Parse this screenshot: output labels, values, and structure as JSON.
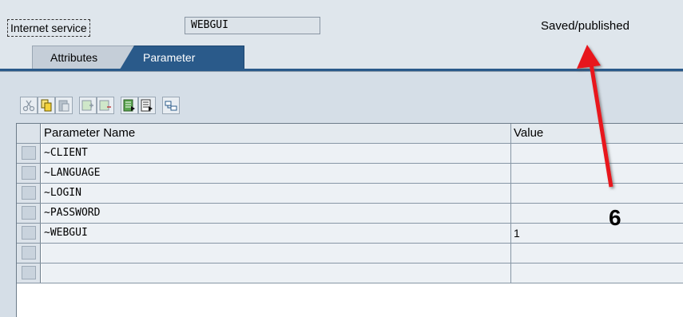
{
  "header": {
    "field_label": "Internet service",
    "field_value": "WEBGUI",
    "status": "Saved/published"
  },
  "tabs": [
    {
      "label": "Attributes",
      "active": false
    },
    {
      "label": "Parameter",
      "active": true
    }
  ],
  "toolbar": {
    "buttons": [
      "cut-icon",
      "copy-icon",
      "paste-icon",
      "insert-row-icon",
      "delete-row-icon",
      "select-all-icon",
      "deselect-all-icon",
      "details-icon"
    ]
  },
  "table": {
    "columns": [
      "Parameter Name",
      "Value"
    ],
    "rows": [
      {
        "name": "~CLIENT",
        "value": ""
      },
      {
        "name": "~LANGUAGE",
        "value": ""
      },
      {
        "name": "~LOGIN",
        "value": ""
      },
      {
        "name": "~PASSWORD",
        "value": ""
      },
      {
        "name": "~WEBGUI",
        "value": "1"
      },
      {
        "name": "",
        "value": ""
      },
      {
        "name": "",
        "value": ""
      }
    ]
  },
  "annotation": {
    "number": "6",
    "arrow_color": "#e8121a"
  },
  "colors": {
    "active_tab": "#2a5a8a",
    "panel": "#d5dee7"
  }
}
